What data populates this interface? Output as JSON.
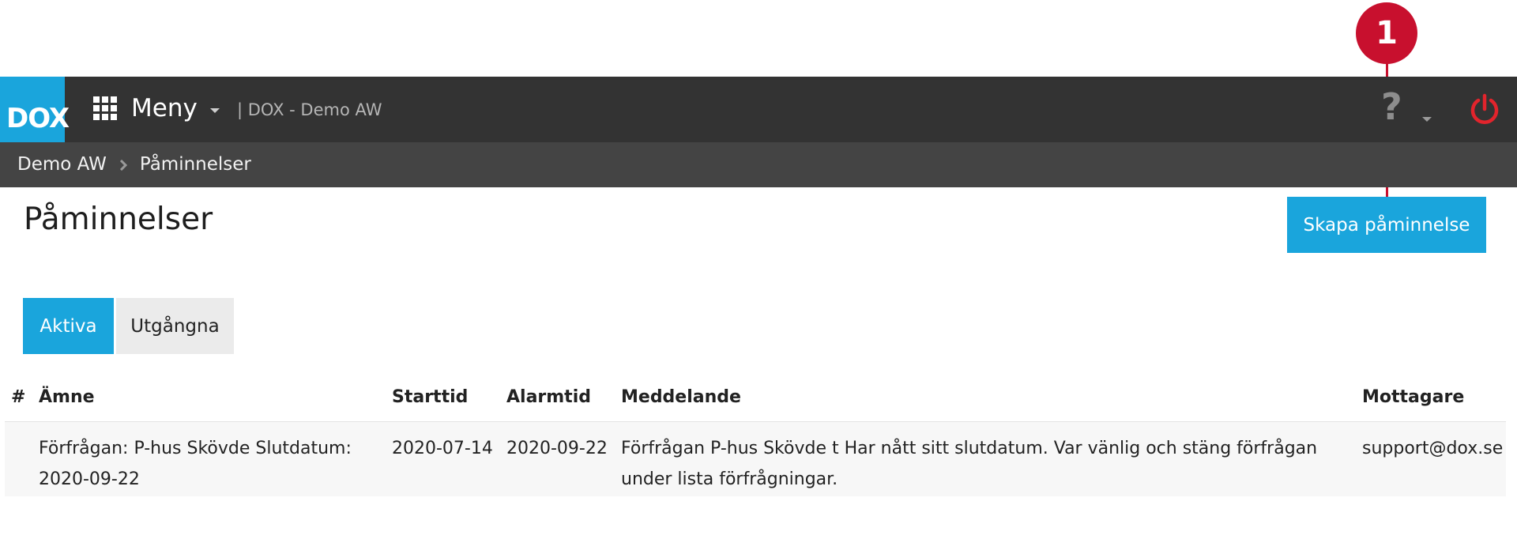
{
  "callout": {
    "number": "1"
  },
  "topbar": {
    "logo_text": "DOX",
    "menu_label": "Meny",
    "app_title": "| DOX - Demo AW",
    "help_label": "?"
  },
  "breadcrumb": {
    "items": [
      "Demo AW",
      "Påminnelser"
    ]
  },
  "page": {
    "title": "Påminnelser",
    "create_button": "Skapa påminnelse"
  },
  "tabs": {
    "active": "Aktiva",
    "expired": "Utgångna"
  },
  "table": {
    "headers": {
      "number": "#",
      "subject": "Ämne",
      "start": "Starttid",
      "alarm": "Alarmtid",
      "message": "Meddelande",
      "recipient": "Mottagare"
    },
    "rows": [
      {
        "subject_line1": "Förfrågan: P-hus Skövde Slutdatum:",
        "subject_line2": "2020-09-22",
        "start": "2020-07-14",
        "alarm": "2020-09-22",
        "message_line1": "Förfrågan P-hus Skövde t Har nått sitt slutdatum. Var vänlig och stäng förfrågan",
        "message_line2": "under lista förfrågningar.",
        "recipient": "support@dox.se"
      }
    ]
  },
  "colors": {
    "accent": "#1aa5dc",
    "topbar": "#333333",
    "breadcrumb_bar": "#444444",
    "callout": "#c8102e",
    "power": "#e2242c"
  },
  "icons": {
    "menu": "grid-icon",
    "menu_caret": "caret-down-icon",
    "help": "question-icon",
    "power": "power-icon",
    "breadcrumb_separator": "chevron-right-icon"
  }
}
